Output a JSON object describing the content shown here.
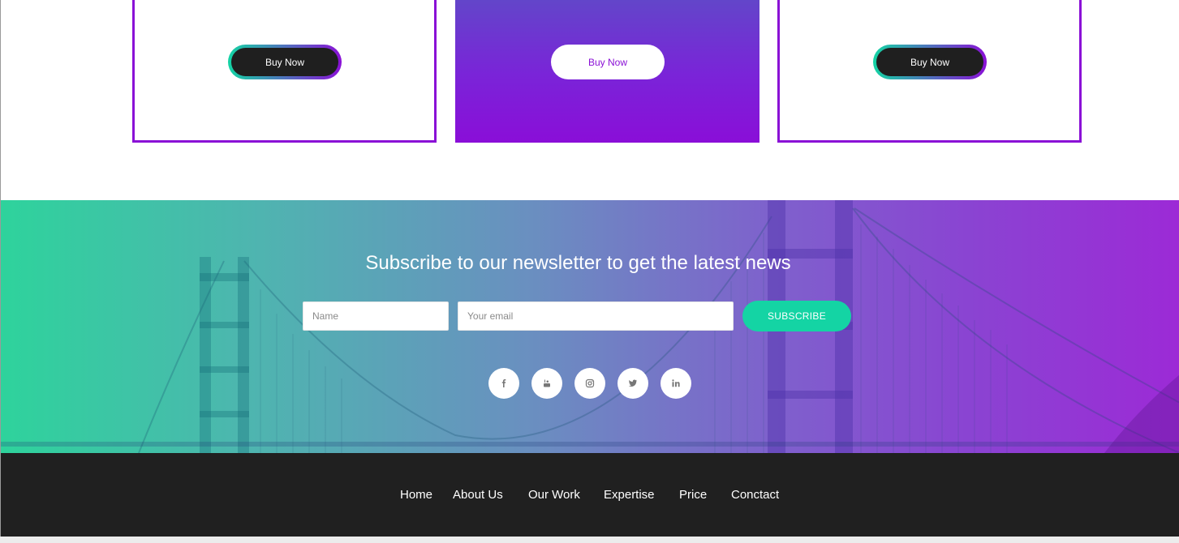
{
  "pricing": {
    "cards": [
      {
        "button_label": "Buy Now",
        "style": "outline"
      },
      {
        "button_label": "Buy Now",
        "style": "filled"
      },
      {
        "button_label": "Buy Now",
        "style": "outline"
      }
    ]
  },
  "newsletter": {
    "title": "Subscribe to our newsletter to get the latest news",
    "name_placeholder": "Name",
    "email_placeholder": "Your email",
    "subscribe_label": "SUBSCRIBE",
    "social_icons": [
      "facebook-icon",
      "youtube-icon",
      "instagram-icon",
      "twitter-icon",
      "linkedin-icon"
    ]
  },
  "footer": {
    "links": [
      "Home",
      "About Us",
      "Our Work",
      "Expertise",
      "Price",
      "Conctact"
    ]
  },
  "colors": {
    "accent_purple": "#8a10d6",
    "accent_teal": "#14d4a4",
    "footer_bg": "#202020"
  }
}
